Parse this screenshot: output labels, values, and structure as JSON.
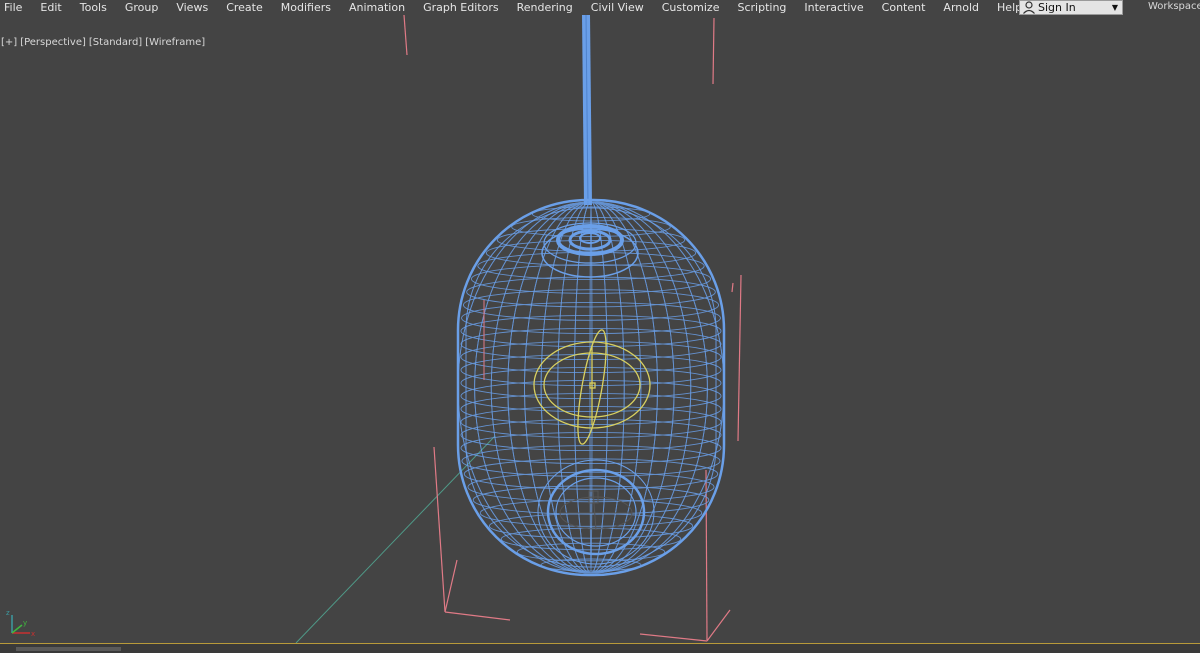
{
  "menubar": {
    "items": [
      "File",
      "Edit",
      "Tools",
      "Group",
      "Views",
      "Create",
      "Modifiers",
      "Animation",
      "Graph Editors",
      "Rendering",
      "Civil View",
      "Customize",
      "Scripting",
      "Interactive",
      "Content",
      "Arnold",
      "Help"
    ]
  },
  "account": {
    "signin_label": "Sign In",
    "user_icon": "user-icon",
    "dropdown_icon": "caret-down-icon",
    "workspaces_label": "Workspaces"
  },
  "viewport": {
    "labels": [
      "[+]",
      "[Perspective]",
      "[Standard]",
      "[Wireframe]"
    ]
  },
  "colors": {
    "background": "#444444",
    "wireframe": "#6a9fe8",
    "bounding_box": "#e07a86",
    "gizmo": "#d8d060",
    "grid_axis": "#4f9a88"
  }
}
